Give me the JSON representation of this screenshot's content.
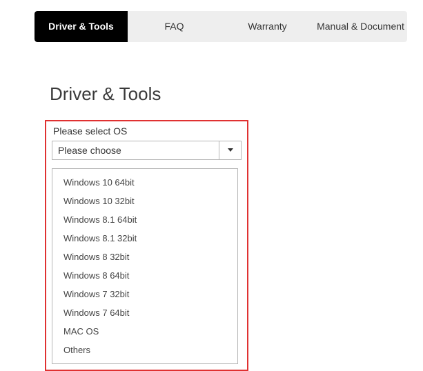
{
  "tabs": {
    "driver_tools": "Driver & Tools",
    "faq": "FAQ",
    "warranty": "Warranty",
    "manual_document": "Manual & Document"
  },
  "heading": "Driver & Tools",
  "os_section": {
    "label": "Please select OS",
    "selected": "Please choose",
    "options": [
      "Windows 10 64bit",
      "Windows 10 32bit",
      "Windows 8.1 64bit",
      "Windows 8.1 32bit",
      "Windows 8 32bit",
      "Windows 8 64bit",
      "Windows 7 32bit",
      "Windows 7 64bit",
      "MAC OS",
      "Others"
    ]
  }
}
